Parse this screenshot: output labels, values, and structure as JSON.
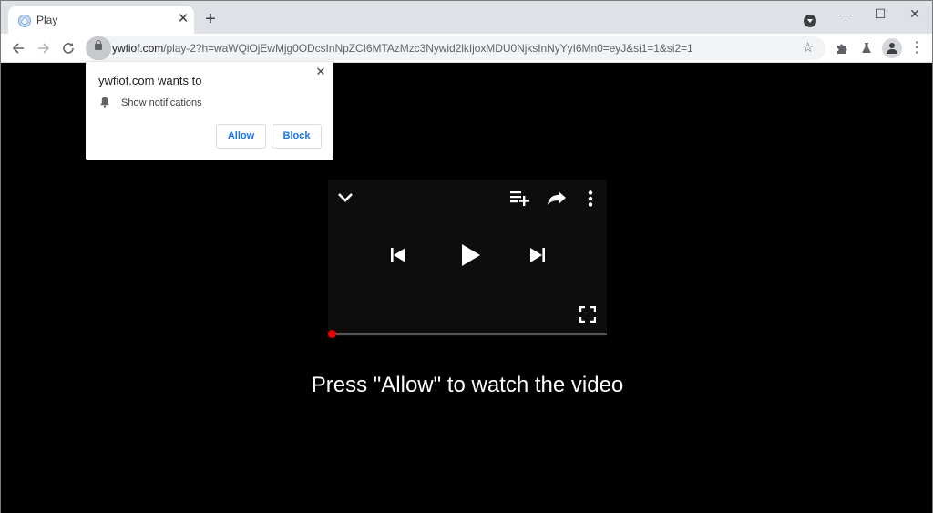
{
  "browser": {
    "tab": {
      "title": "Play",
      "favicon": "globe-icon"
    },
    "new_tab_label": "+",
    "window_controls": {
      "minimize": "—",
      "maximize": "☐",
      "close": "✕"
    },
    "url": {
      "host": "ywfiof.com",
      "path": "/play-2?h=waWQiOjEwMjg0ODcsInNpZCI6MTAzMzc3Nywid2lkIjoxMDU0NjksInNyYyI6Mn0=eyJ&si1=1&si2=1"
    },
    "icons": {
      "back": "back-arrow-icon",
      "forward": "forward-arrow-icon",
      "reload": "reload-icon",
      "lock": "lock-icon",
      "bookmark": "star-icon",
      "extensions": "puzzle-icon",
      "labs": "flask-icon",
      "profile": "avatar-icon",
      "menu": "kebab-menu-icon",
      "tab_search": "tab-search-icon"
    }
  },
  "notification_prompt": {
    "heading": "ywfiof.com wants to",
    "permission": "Show notifications",
    "permission_icon": "bell-icon",
    "allow_label": "Allow",
    "block_label": "Block",
    "close_label": "✕"
  },
  "player": {
    "icons": [
      "chevron-down-icon",
      "add-to-queue-icon",
      "share-icon",
      "more-vert-icon",
      "skip-previous-icon",
      "play-icon",
      "skip-next-icon",
      "fullscreen-icon"
    ],
    "progress": 0,
    "progress_color": "#ee0000"
  },
  "page": {
    "caption": "Press \"Allow\" to watch the video"
  }
}
